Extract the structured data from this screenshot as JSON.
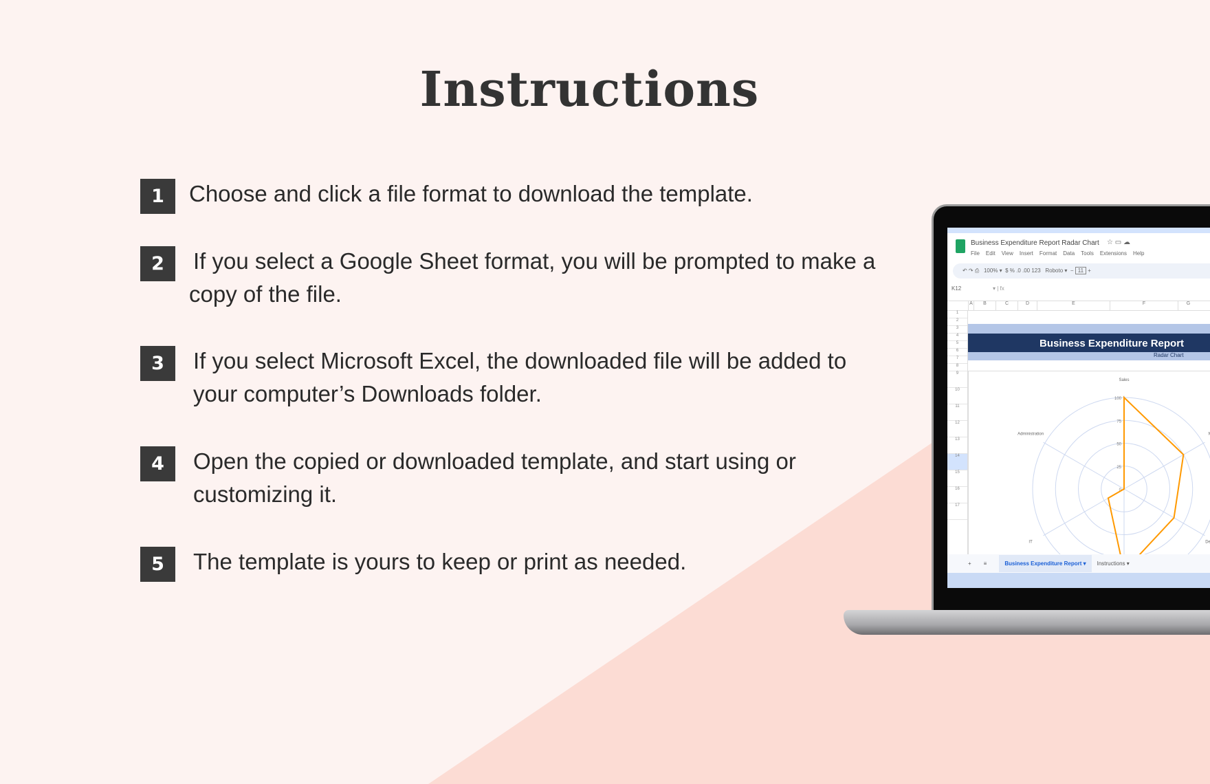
{
  "title": "Instructions",
  "steps": [
    {
      "n": "1",
      "text": " Choose and click a file format to download the template."
    },
    {
      "n": "2",
      "text": " If you select a Google Sheet format, you will be prompted to make a copy of the file."
    },
    {
      "n": "3",
      "text": "If you select Microsoft Excel, the downloaded file will be added to your computer’s Downloads folder."
    },
    {
      "n": "4",
      "text": "Open the copied or downloaded template, and start using or customizing it."
    },
    {
      "n": "5",
      "text": "The template is yours to keep or print as needed."
    }
  ],
  "colors": {
    "background": "#fdf3f1",
    "triangle": "#fcdcd4",
    "step_box": "#3a3a3a",
    "header_band": "#1f3763",
    "series": "#ff9900"
  },
  "laptop": {
    "doc_title": "Business Expenditure Report Radar Chart",
    "menu": [
      "File",
      "Edit",
      "View",
      "Insert",
      "Format",
      "Data",
      "Tools",
      "Extensions",
      "Help"
    ],
    "zoom": "100%",
    "font": "Roboto",
    "font_size": "11",
    "cell_ref": "K12",
    "columns": [
      "A",
      "B",
      "C",
      "D",
      "E",
      "F",
      "G"
    ],
    "rows": [
      "1",
      "2",
      "3",
      "4",
      "5",
      "6",
      "7",
      "8",
      "9",
      "10",
      "11",
      "12",
      "13",
      "14",
      "15",
      "16",
      "17"
    ],
    "report_title": "Business Expenditure Report",
    "report_subtitle": "Radar Chart",
    "sheet_tabs": [
      "Business Expenditure Report",
      "Instructions"
    ],
    "chart_data": {
      "type": "radar",
      "categories": [
        "Sales",
        "Marketing",
        "Development",
        "",
        "IT",
        "Administration"
      ],
      "values": [
        100,
        75,
        63,
        90,
        20,
        0
      ],
      "ticks": [
        "0",
        "25",
        "50",
        "75",
        "100"
      ],
      "rmax": 100
    }
  }
}
